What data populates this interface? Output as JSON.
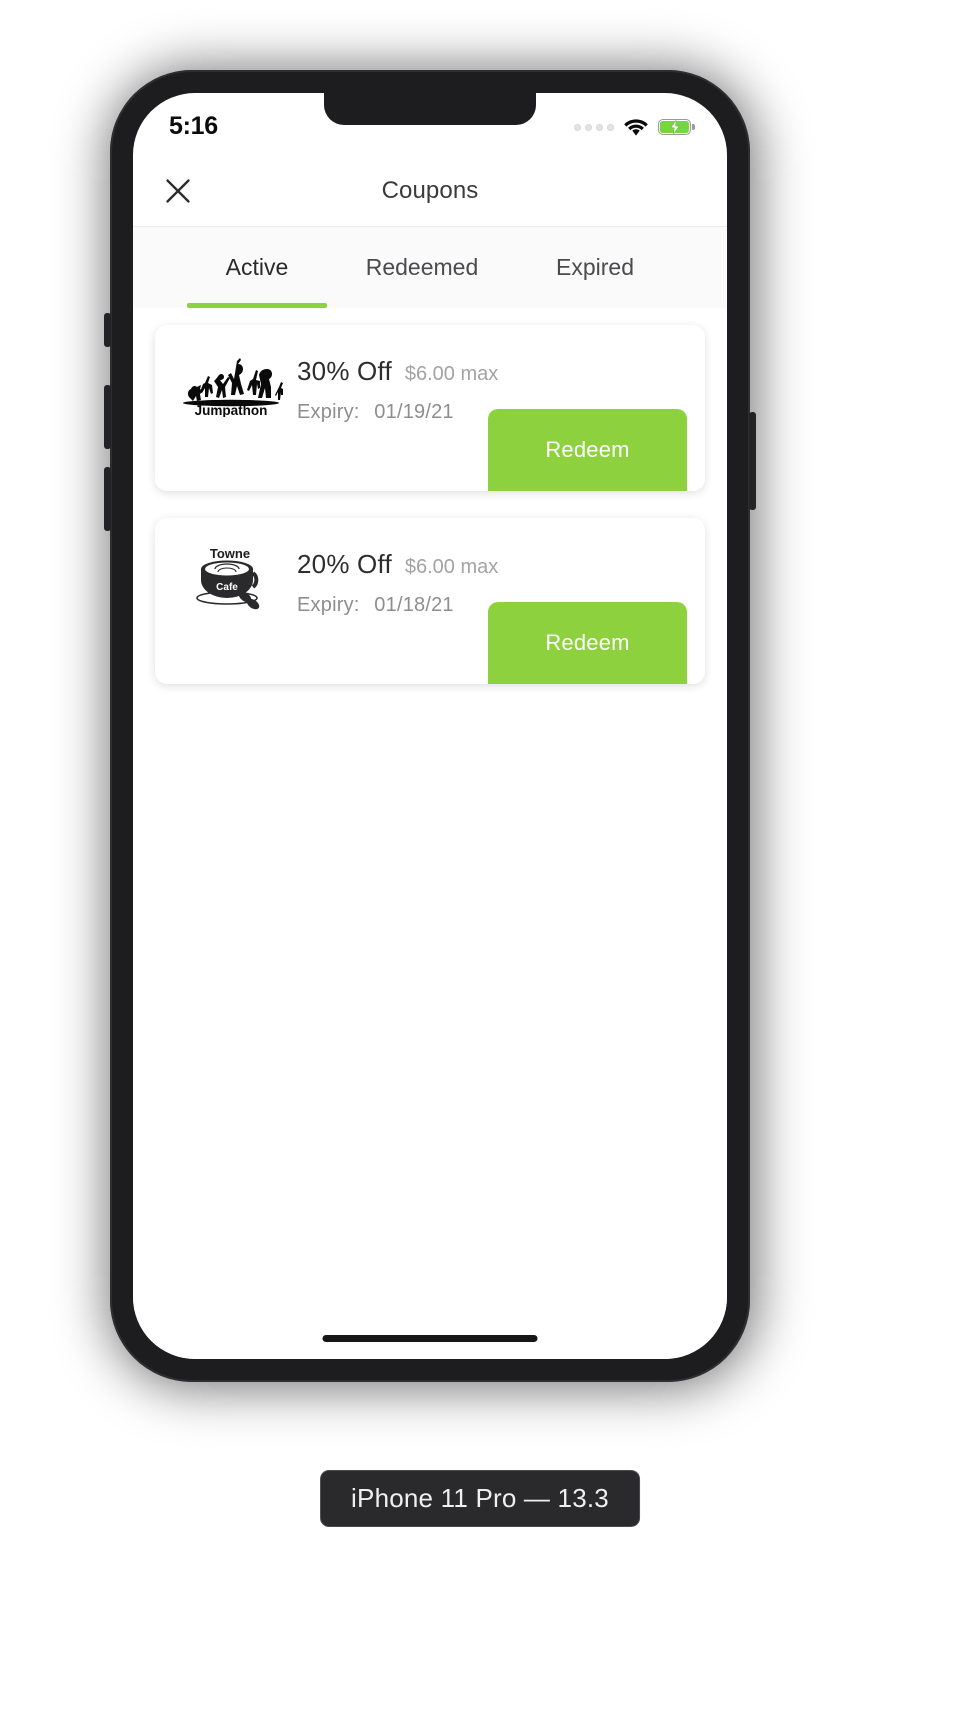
{
  "status_bar": {
    "time": "5:16",
    "signal_icon": "signal-dots-icon",
    "wifi_icon": "wifi-icon",
    "battery_icon": "battery-charging-icon",
    "battery_color": "#77d63f"
  },
  "header": {
    "title": "Coupons",
    "close_icon": "close-icon"
  },
  "tabs": {
    "items": [
      {
        "label": "Active",
        "active": true
      },
      {
        "label": "Redeemed",
        "active": false
      },
      {
        "label": "Expired",
        "active": false
      }
    ],
    "indicator_color": "#8ed13f"
  },
  "coupons": [
    {
      "merchant": "Jumpathon",
      "logo_icon": "jumpathon-logo",
      "discount": "30% Off",
      "max_value": "$6.00 max",
      "expiry_label": "Expiry:",
      "expiry_date": "01/19/21",
      "action_label": "Redeem",
      "action_color": "#8ed13f"
    },
    {
      "merchant": "Towne Cafe",
      "logo_icon": "towne-cafe-logo",
      "discount": "20% Off",
      "max_value": "$6.00 max",
      "expiry_label": "Expiry:",
      "expiry_date": "01/18/21",
      "action_label": "Redeem",
      "action_color": "#8ed13f"
    }
  ],
  "device": {
    "label": "iPhone 11 Pro — 13.3"
  }
}
